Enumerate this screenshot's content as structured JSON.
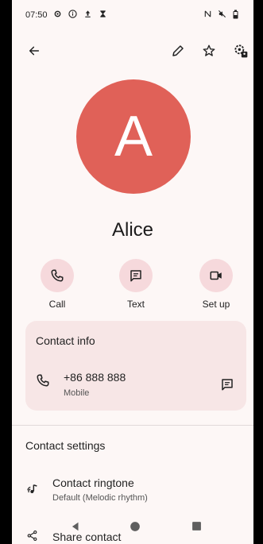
{
  "status": {
    "time": "07:50",
    "left_icons": [
      "settings-icon",
      "info-icon",
      "upload-icon",
      "hourglass-icon"
    ],
    "right_icons": [
      "nfc-icon",
      "mute-icon",
      "battery-icon"
    ]
  },
  "appbar": {
    "icons": [
      "back-arrow-icon",
      "edit-icon",
      "star-icon",
      "contact-settings-icon"
    ]
  },
  "contact": {
    "initial": "A",
    "name": "Alice",
    "avatar_color": "#e06158"
  },
  "actions": [
    {
      "label": "Call",
      "icon": "phone-icon"
    },
    {
      "label": "Text",
      "icon": "message-icon"
    },
    {
      "label": "Set up",
      "icon": "video-icon"
    }
  ],
  "contact_info": {
    "title": "Contact info",
    "number": "+86 888 888",
    "number_type": "Mobile"
  },
  "contact_settings": {
    "title": "Contact settings",
    "ringtone_title": "Contact ringtone",
    "ringtone_value": "Default (Melodic rhythm)",
    "share_label": "Share contact"
  },
  "colors": {
    "background": "#fdf7f6",
    "accent_circle": "#f6d9dc",
    "card": "#f7e6e6"
  }
}
